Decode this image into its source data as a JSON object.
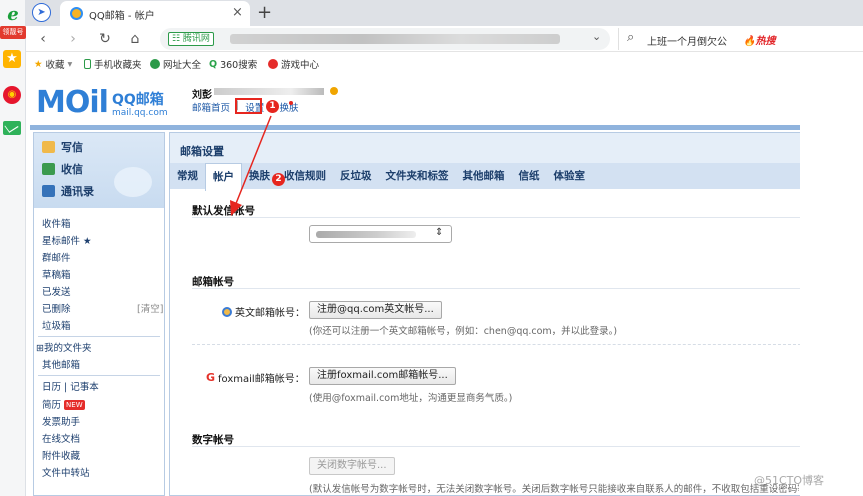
{
  "browser": {
    "rail": {
      "badge": "领靓号"
    },
    "tab": {
      "title": "QQ邮箱 - 帐户",
      "close": "×",
      "new": "+"
    },
    "toolbar": {
      "back": "‹",
      "forward": "›",
      "reload": "↻",
      "home": "⌂",
      "site_badge": "☷ 腾讯网",
      "search_text": "上班一个月倒欠公",
      "hot": "🔥热搜"
    },
    "bookmarks": [
      "收藏",
      "手机收藏夹",
      "网址大全",
      "360搜索",
      "游戏中心"
    ]
  },
  "header": {
    "logo_big": "MOil",
    "logo_cn": "QQ邮箱",
    "logo_domain": "mail.qq.com",
    "user_name": "刘彭",
    "links": [
      "邮箱首页",
      "设置",
      "换肤"
    ],
    "separator": "|",
    "marker1": "1",
    "marker2": "2"
  },
  "sidebar": {
    "actions": [
      "写信",
      "收信",
      "通讯录"
    ],
    "folders": [
      "收件箱",
      "星标邮件 ★",
      "群邮件",
      "草稿箱",
      "已发送",
      "已删除",
      "垃圾箱"
    ],
    "deleted_extra": "[清空]",
    "my_folders": "⊞我的文件夹",
    "other_mail": "其他邮箱",
    "tools": [
      "日历 | 记事本",
      "简历",
      "发票助手",
      "在线文档",
      "附件收藏",
      "文件中转站"
    ],
    "new_badge": "NEW"
  },
  "main": {
    "title": "邮箱设置",
    "tabs": [
      "常规",
      "帐户",
      "换肤",
      "收信规则",
      "反垃圾",
      "文件夹和标签",
      "其他邮箱",
      "信纸",
      "体验室"
    ],
    "sections": {
      "default_sender": "默认发信帐号",
      "mail_accounts": "邮箱帐号",
      "digital_account": "数字帐号"
    },
    "english_label": "英文邮箱帐号：",
    "english_button": "注册@qq.com英文帐号...",
    "english_hint": "(你还可以注册一个英文邮箱帐号，例如：chen@qq.com，并以此登录。)",
    "foxmail_label": "foxmail邮箱帐号：",
    "foxmail_button": "注册foxmail.com邮箱帐号...",
    "foxmail_hint": "(使用@foxmail.com地址，沟通更显商务气质。)",
    "digital_button": "关闭数字帐号...",
    "digital_hint": "(默认发信帐号为数字帐号时，无法关闭数字帐号。关闭后数字帐号只能接收来自联系人的邮件，不收取包括重设密码等系统"
  },
  "watermark": "@51CTO博客"
}
